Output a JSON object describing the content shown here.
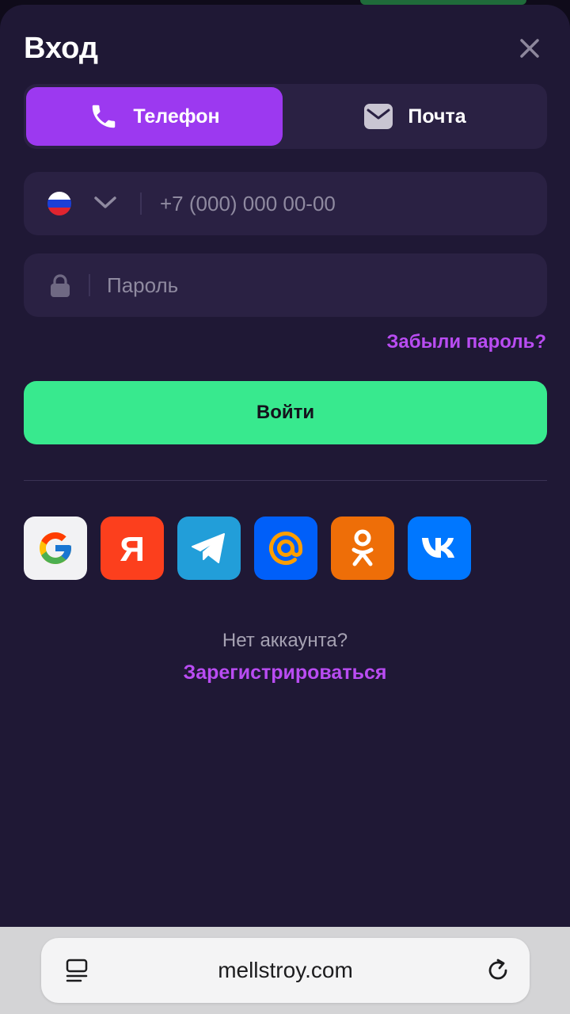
{
  "dialog": {
    "title": "Вход",
    "close_icon": "close-icon"
  },
  "tabs": [
    {
      "label": "Телефон",
      "icon": "phone-icon",
      "active": true
    },
    {
      "label": "Почта",
      "icon": "mail-icon",
      "active": false
    }
  ],
  "phone_field": {
    "country_flag": "russia-flag-icon",
    "value": "",
    "placeholder": "+7 (000) 000 00-00"
  },
  "password_field": {
    "value": "",
    "placeholder": "Пароль"
  },
  "forgot_password": "Забыли пароль?",
  "login_button": "Войти",
  "social_logins": [
    {
      "name": "google",
      "icon": "google-icon",
      "color": "#ffffff"
    },
    {
      "name": "yandex",
      "icon": "yandex-icon",
      "color": "#fc3f1d"
    },
    {
      "name": "telegram",
      "icon": "telegram-icon",
      "color": "#229ed9"
    },
    {
      "name": "mail-ru",
      "icon": "at-icon",
      "color": "#005ff9"
    },
    {
      "name": "odnoklassniki",
      "icon": "ok-icon",
      "color": "#ee8208"
    },
    {
      "name": "vk",
      "icon": "vk-icon",
      "color": "#0077ff"
    }
  ],
  "register_prompt": "Нет аккаунта?",
  "register_link": "Зарегистрироваться",
  "browser": {
    "url": "mellstroy.com"
  },
  "colors": {
    "background": "#1f1835",
    "field": "#2a2143",
    "accent_purple": "#9c39f0",
    "link_purple": "#b94cf2",
    "primary_green": "#38e98e"
  }
}
